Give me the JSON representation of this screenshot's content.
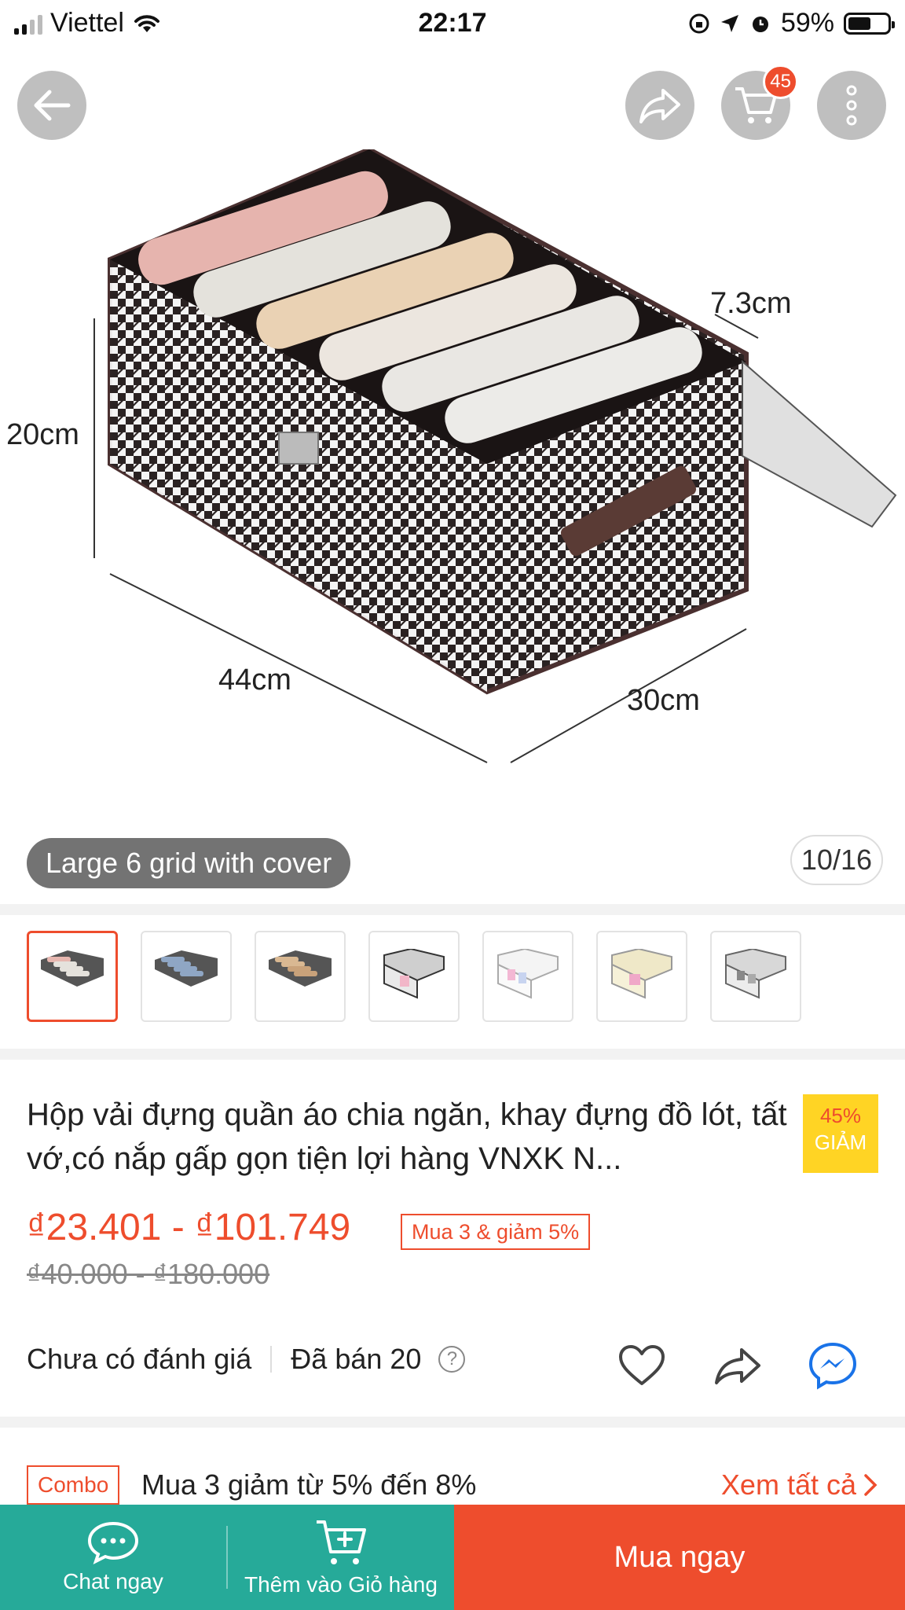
{
  "status_bar": {
    "carrier": "Viettel",
    "time": "22:17",
    "battery": "59%",
    "battery_level": 0.59
  },
  "nav": {
    "cart_count": "45"
  },
  "gallery": {
    "variant_label": "Large 6 grid with cover",
    "counter": "10/16",
    "dimensions": {
      "height": "20cm",
      "length": "44cm",
      "width": "30cm",
      "depth": "7.3cm"
    },
    "thumbnails": [
      "thumb-1",
      "thumb-2",
      "thumb-3",
      "thumb-4",
      "thumb-5",
      "thumb-6",
      "thumb-7"
    ]
  },
  "product": {
    "title": "Hộp vải đựng quần áo chia ngăn, khay đựng đồ lót, tất vớ,có nắp gấp gọn tiện lợi hàng VNXK N...",
    "discount_pct": "45%",
    "discount_label": "GIẢM",
    "price_range": "₫23.401 - ₫101.749",
    "promo": "Mua 3 & giảm 5%",
    "old_price": "₫40.000 - ₫180.000",
    "rating_text": "Chưa có đánh giá",
    "sold_text": "Đã bán 20"
  },
  "combo": {
    "tag": "Combo",
    "text": "Mua 3 giảm từ 5% đến 8%",
    "link": "Xem tất cả"
  },
  "bottom_bar": {
    "chat_label": "Chat ngay",
    "add_cart_label": "Thêm vào Giỏ hàng",
    "buy_label": "Mua ngay"
  },
  "colors": {
    "brand": "#ee4d2d",
    "chat_bar": "#26aa99",
    "discount_bg": "#ffd424",
    "messenger": "#1a73e8"
  }
}
